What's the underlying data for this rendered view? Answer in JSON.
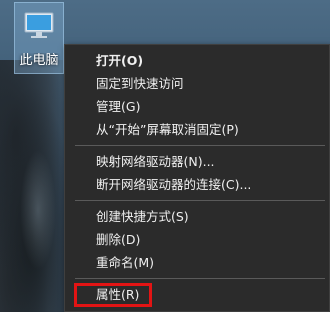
{
  "desktop": {
    "icon": "this-pc-icon",
    "label": "此电脑"
  },
  "context_menu": {
    "group1": [
      "打开(O)",
      "固定到快速访问",
      "管理(G)",
      "从“开始”屏幕取消固定(P)"
    ],
    "group2": [
      "映射网络驱动器(N)...",
      "断开网络驱动器的连接(C)..."
    ],
    "group3": [
      "创建快捷方式(S)",
      "删除(D)",
      "重命名(M)"
    ],
    "group4": [
      "属性(R)"
    ],
    "highlight_color": "#e31414"
  }
}
